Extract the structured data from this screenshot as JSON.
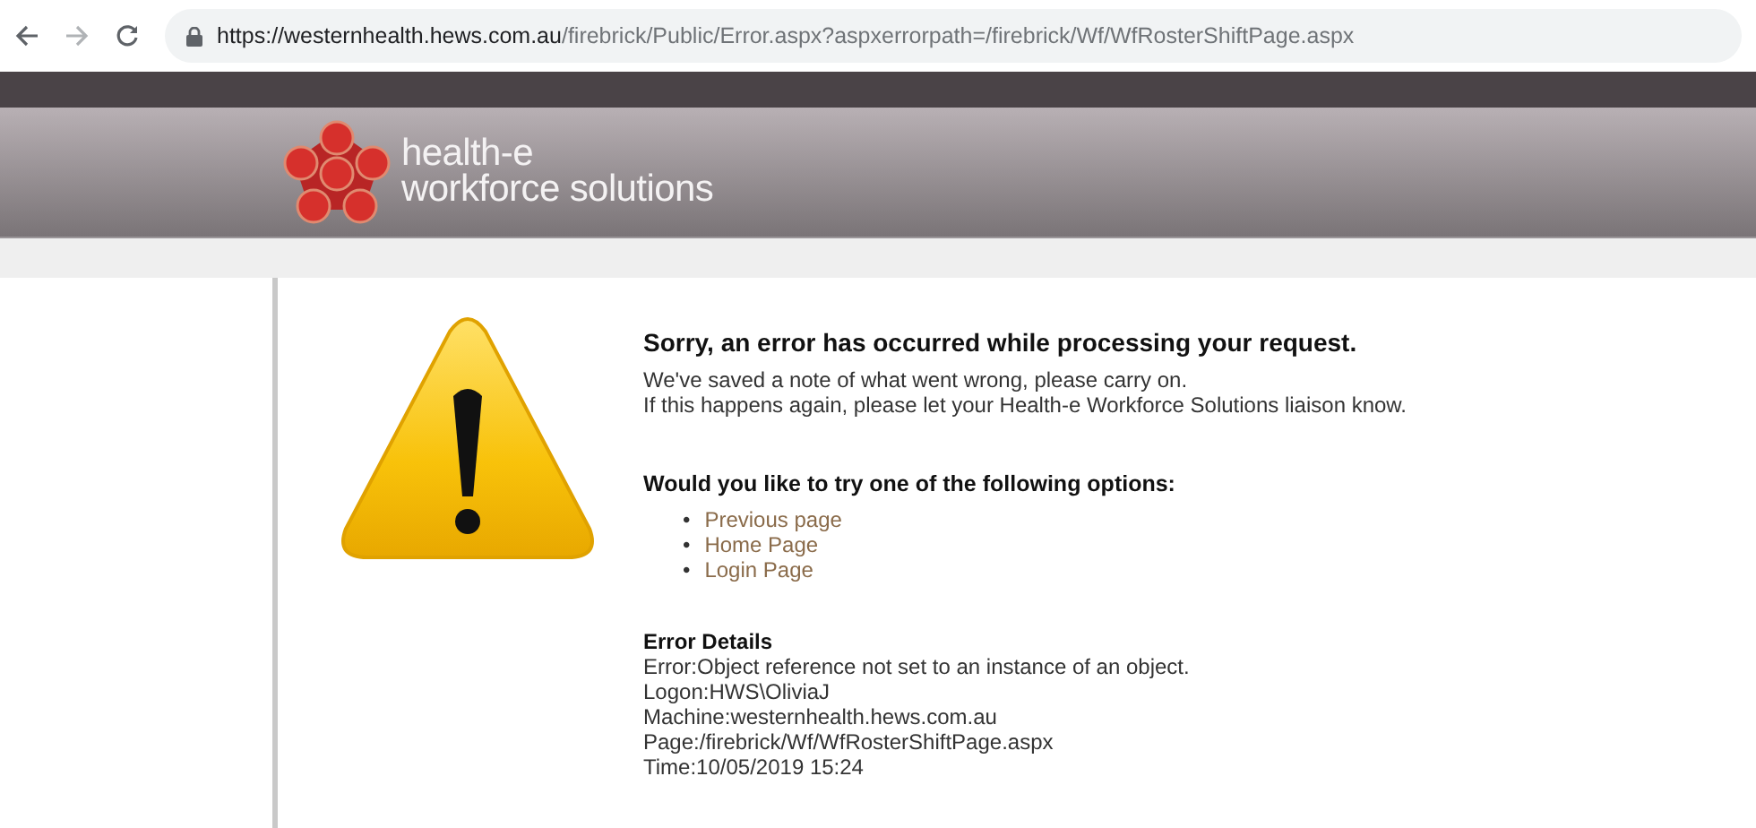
{
  "browser": {
    "url_host": "https://westernhealth.hews.com.au",
    "url_path": "/firebrick/Public/Error.aspx?aspxerrorpath=/firebrick/Wf/WfRosterShiftPage.aspx"
  },
  "logo": {
    "line_1": "health-e",
    "line_2": "workforce solutions"
  },
  "error": {
    "title": "Sorry, an error has occurred while processing your request.",
    "messages": [
      "We've saved a note of what went wrong, please carry on.",
      "If this happens again, please let your Health-e Workforce Solutions liaison know."
    ],
    "options_heading": "Would you like to try one of the following options:",
    "options": [
      {
        "bullet": "•",
        "label": "Previous page"
      },
      {
        "bullet": "•",
        "label": "Home Page"
      },
      {
        "bullet": "•",
        "label": "Login Page"
      }
    ],
    "details_heading": "Error Details",
    "details": [
      "Error:Object reference not set to an instance of an object.",
      "Logon:HWS\\OliviaJ",
      "Machine:westernhealth.hews.com.au",
      "Page:/firebrick/Wf/WfRosterShiftPage.aspx",
      "Time:10/05/2019 15:24"
    ]
  }
}
